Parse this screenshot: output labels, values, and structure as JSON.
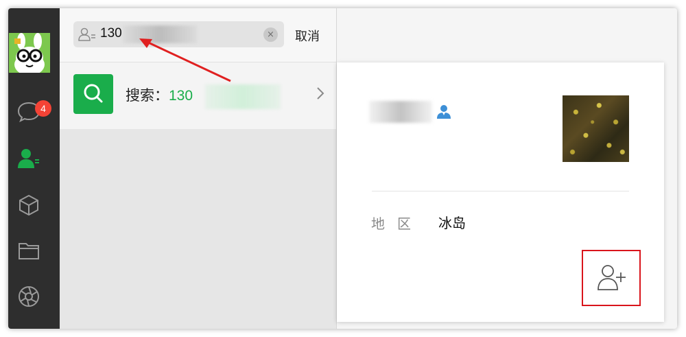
{
  "sidebar": {
    "unread_badge": "4",
    "items": [
      {
        "icon": "chat-icon"
      },
      {
        "icon": "contacts-icon"
      },
      {
        "icon": "cube-icon"
      },
      {
        "icon": "folder-icon"
      },
      {
        "icon": "aperture-icon"
      }
    ]
  },
  "search": {
    "query": "130",
    "clear_symbol": "×",
    "cancel_label": "取消"
  },
  "result": {
    "label": "搜索：",
    "value": "130",
    "chevron": "chevron-right-icon"
  },
  "profile_card": {
    "region_label": "地区",
    "region_value": "冰岛",
    "add_friend_icon": "add-user-icon"
  },
  "colors": {
    "accent_green": "#1aad4b",
    "badge_red": "#f44336",
    "highlight_red": "#d9141b",
    "sidebar_bg": "#2e2e2e"
  }
}
